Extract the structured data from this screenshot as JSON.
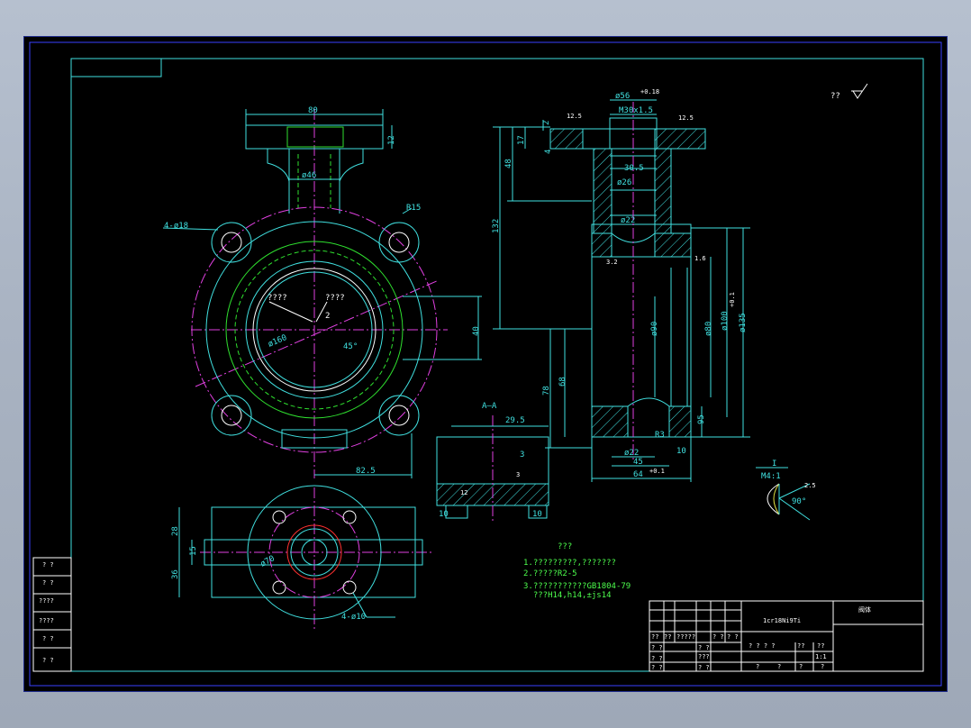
{
  "top_note": "?? ",
  "front_view": {
    "dims": [
      "80",
      "12",
      "ø46",
      "R15",
      "4-ø18",
      "ø160",
      "45°",
      "2",
      "40",
      "82.5"
    ],
    "labels": [
      "????",
      "????"
    ]
  },
  "side_view": {
    "dims": [
      "ø56",
      "M30x1.5",
      "2",
      "17",
      "4",
      "48",
      "132",
      "30.5",
      "ø26",
      "ø22",
      "78",
      "68",
      "ø80",
      "ø90",
      "ø100",
      "ø135",
      "ø22",
      "45",
      "64",
      "10",
      "R3",
      "95",
      "1.6",
      "12.5",
      "3.2"
    ],
    "tolerance_upper": "+0.18",
    "tolerance_fit": "+0.1",
    "tolerance_64": "+0.1"
  },
  "section": {
    "title": "A—A",
    "dims": [
      "29.5",
      "3",
      "10",
      "10",
      "12",
      "3"
    ]
  },
  "bottom_view": {
    "dims": [
      "28",
      "15",
      "36",
      "ø70",
      "4-ø10"
    ]
  },
  "detail": {
    "title": "I",
    "scale": "M4:1",
    "dims": [
      "90°",
      "2.5"
    ]
  },
  "notes": {
    "heading": "???",
    "lines": [
      "1.?????????,???????",
      "2.?????R2-5",
      "3.???????????GB1804-79",
      "  ???H14,h14,±js14"
    ]
  },
  "title_block": {
    "material": "1cr18Ni9Ti",
    "part_name": "阀体",
    "cells_row_a": [
      "??",
      "??",
      "?????",
      "? ?",
      "? ?"
    ],
    "cells_row_b": [
      "? ?",
      "? ?",
      "???"
    ],
    "cells_row_c": [
      "? ?",
      "? ?",
      "? ?"
    ],
    "cells_row_d": [
      "? ? ? ?",
      "??",
      "??"
    ],
    "scale_value": "1:1",
    "cells_row_e": [
      "?",
      "?",
      "?",
      "?"
    ]
  },
  "left_strip": {
    "rows": [
      "? ?",
      "? ?",
      "????",
      "????",
      "? ?",
      "? ?"
    ]
  }
}
